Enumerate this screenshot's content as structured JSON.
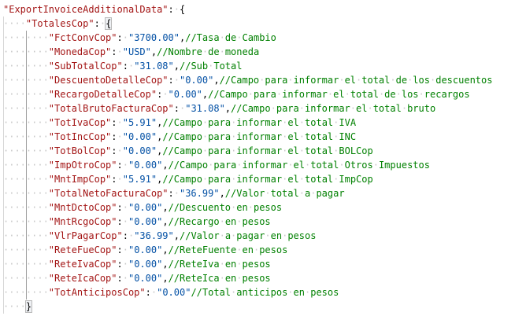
{
  "editor": {
    "lines": [
      {
        "indent": 0,
        "key": "ExportInvoiceAdditionalData",
        "open": "{",
        "highlight": false
      },
      {
        "indent": 1,
        "key": "TotalesCop",
        "open": "{",
        "highlight": true
      },
      {
        "indent": 2,
        "key": "FctConvCop",
        "value": "\"3700.00\"",
        "sep": ",",
        "comment": "//Tasa de Cambio"
      },
      {
        "indent": 2,
        "key": "MonedaCop",
        "value": "\"USD\"",
        "sep": ",",
        "comment": "//Nombre de moneda"
      },
      {
        "indent": 2,
        "key": "SubTotalCop",
        "value": "\"31.08\"",
        "sep": ",",
        "comment": "//Sub Total"
      },
      {
        "indent": 2,
        "key": "DescuentoDetalleCop",
        "value": "\"0.00\"",
        "sep": ",",
        "comment": "//Campo para informar el total de los descuentos"
      },
      {
        "indent": 2,
        "key": "RecargoDetalleCop",
        "value": "\"0.00\"",
        "sep": ",",
        "comment": "//Campo para informar el total de los recargos"
      },
      {
        "indent": 2,
        "key": "TotalBrutoFacturaCop",
        "value": "\"31.08\"",
        "sep": ",",
        "comment": "//Campo para informar el total bruto"
      },
      {
        "indent": 2,
        "key": "TotIvaCop",
        "value": "\"5.91\"",
        "sep": ",",
        "comment": "//Campo para informar el total IVA"
      },
      {
        "indent": 2,
        "key": "TotIncCop",
        "value": "\"0.00\"",
        "sep": ",",
        "comment": "//Campo para informar el total INC"
      },
      {
        "indent": 2,
        "key": "TotBolCop",
        "value": "\"0.00\"",
        "sep": ",",
        "comment": "//Campo para informar el total BOLCop"
      },
      {
        "indent": 2,
        "key": "ImpOtroCop",
        "value": "\"0.00\"",
        "sep": ",",
        "comment": "//Campo para informar el total Otros Impuestos"
      },
      {
        "indent": 2,
        "key": "MntImpCop",
        "value": "\"5.91\"",
        "sep": ",",
        "comment": "//Campo para informar el total ImpCop"
      },
      {
        "indent": 2,
        "key": "TotalNetoFacturaCop",
        "value": "\"36.99\"",
        "sep": ",",
        "comment": "//Valor total a pagar"
      },
      {
        "indent": 2,
        "key": "MntDctoCop",
        "value": "\"0.00\"",
        "sep": ",",
        "comment": "//Descuento en pesos"
      },
      {
        "indent": 2,
        "key": "MntRcgoCop",
        "value": "\"0.00\"",
        "sep": ",",
        "comment": "//Recargo en pesos"
      },
      {
        "indent": 2,
        "key": "VlrPagarCop",
        "value": "\"36.99\"",
        "sep": ",",
        "comment": "//Valor a pagar en pesos"
      },
      {
        "indent": 2,
        "key": "ReteFueCop",
        "value": "\"0.00\"",
        "sep": ",",
        "comment": "//ReteFuente en pesos"
      },
      {
        "indent": 2,
        "key": "ReteIvaCop",
        "value": "\"0.00\"",
        "sep": ",",
        "comment": "//ReteIva en pesos"
      },
      {
        "indent": 2,
        "key": "ReteIcaCop",
        "value": "\"0.00\"",
        "sep": ",",
        "comment": "//ReteIca en pesos"
      },
      {
        "indent": 2,
        "key": "TotAnticiposCop",
        "value": "\"0.00\"",
        "sep": "",
        "comment": "//Total anticipos en pesos"
      },
      {
        "indent": 1,
        "close": "}",
        "highlight": true
      }
    ]
  }
}
